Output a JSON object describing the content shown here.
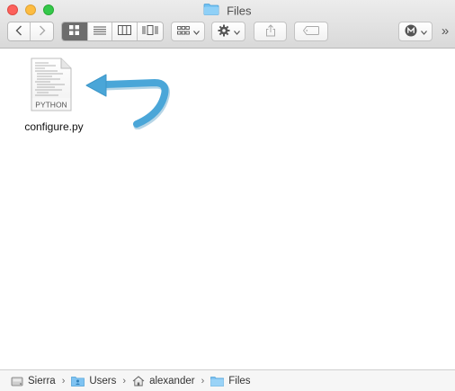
{
  "window": {
    "title": "Files"
  },
  "toolbar": {
    "overflow_label": "»"
  },
  "files": [
    {
      "name": "configure.py",
      "type_label": "PYTHON"
    }
  ],
  "path_bar": [
    {
      "label": "Sierra",
      "icon": "hard-drive-icon"
    },
    {
      "label": "Users",
      "icon": "users-folder-icon"
    },
    {
      "label": "alexander",
      "icon": "home-icon"
    },
    {
      "label": "Files",
      "icon": "folder-icon"
    }
  ],
  "colors": {
    "accent_folder": "#5fb4ee",
    "arrow": "#4aa6d8"
  }
}
